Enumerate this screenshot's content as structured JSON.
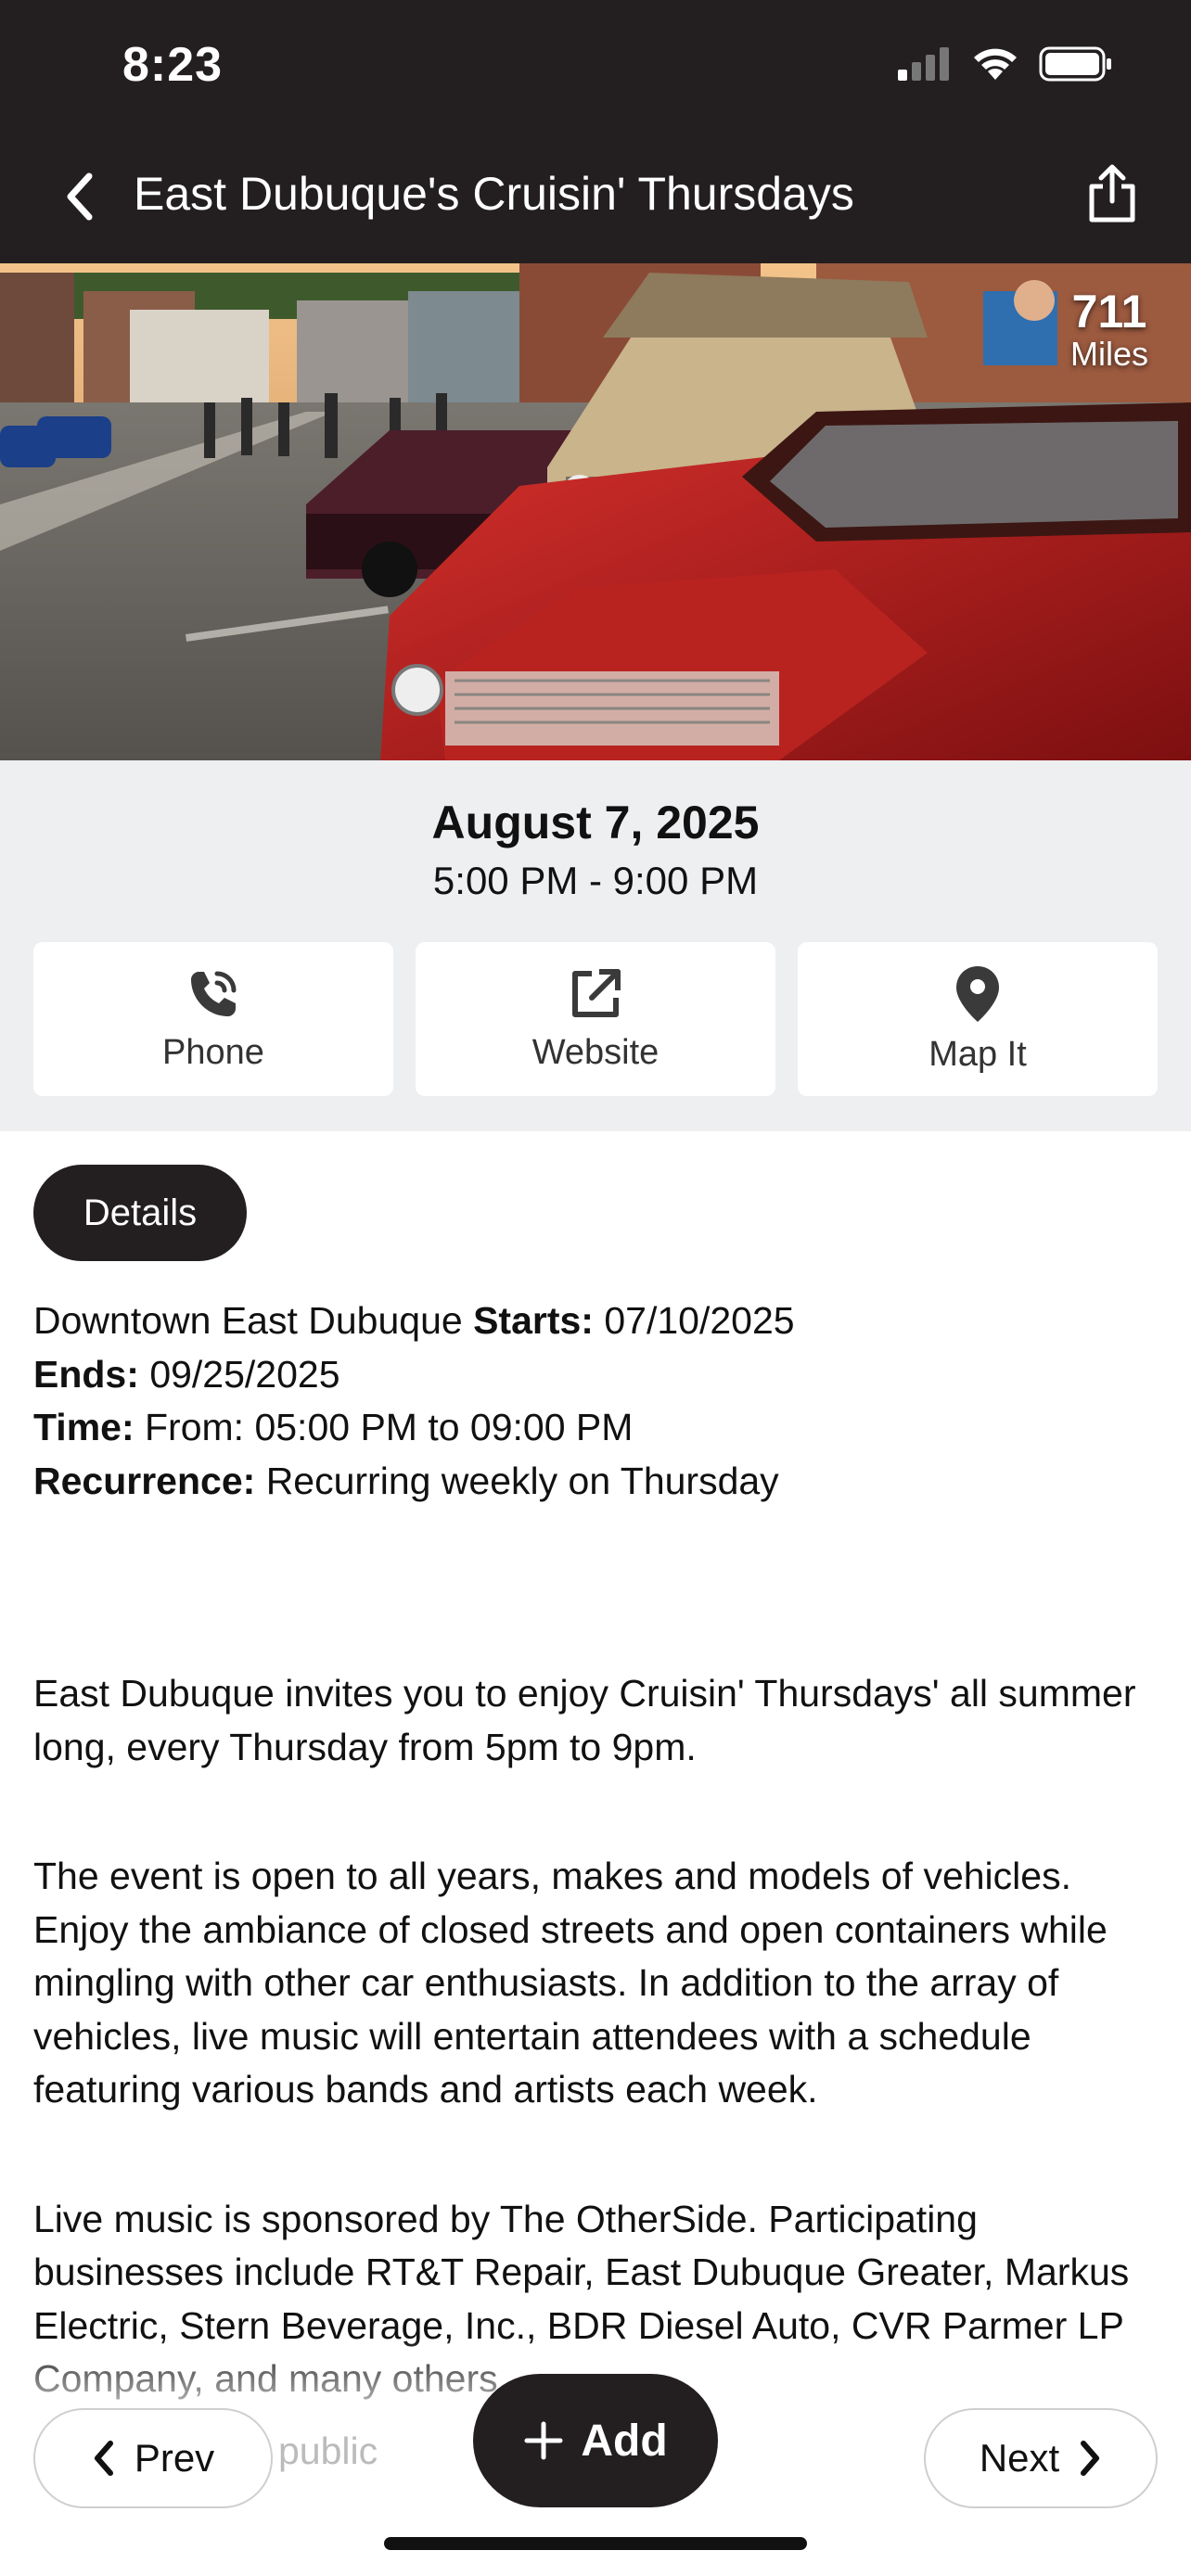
{
  "status_bar": {
    "time": "8:23",
    "icons": [
      "cellular-signal-icon",
      "wifi-icon",
      "battery-icon"
    ]
  },
  "nav": {
    "title": "East Dubuque's Cruisin' Thursdays",
    "back_icon": "chevron-left-icon",
    "share_icon": "share-icon"
  },
  "hero": {
    "image_description": "classic cars parked along a downtown street",
    "distance_value": "711",
    "distance_unit": "Miles"
  },
  "event": {
    "date": "August 7, 2025",
    "time": "5:00 PM - 9:00 PM"
  },
  "actions": [
    {
      "label": "Phone",
      "icon": "phone-icon"
    },
    {
      "label": "Website",
      "icon": "external-link-icon"
    },
    {
      "label": "Map It",
      "icon": "map-pin-icon"
    }
  ],
  "details": {
    "tab_label": "Details",
    "location": "Downtown East Dubuque",
    "starts_label": "Starts:",
    "starts_value": "07/10/2025",
    "ends_label": "Ends:",
    "ends_value": "09/25/2025",
    "time_label": "Time:",
    "time_value": "From: 05:00 PM to 09:00 PM",
    "recurrence_label": "Recurrence:",
    "recurrence_value": "Recurring weekly on Thursday",
    "paragraphs": [
      "East Dubuque invites you to enjoy Cruisin' Thursdays' all summer long, every Thursday from 5pm to 9pm.",
      "The event is open to all years, makes and models of vehicles. Enjoy the ambiance of closed streets and open containers while mingling with other car enthusiasts. In addition to the array of vehicles, live music will entertain attendees with a schedule featuring various bands and artists each week.",
      "Live music is sponsored by The OtherSide. Participating businesses include RT&T Repair, East Dubuque Greater, Markus Electric, Stern Beverage, Inc., BDR Diesel Auto, CVR Parmer LP Company, and many others."
    ],
    "partial_line": "public"
  },
  "bottom_bar": {
    "prev_label": "Prev",
    "add_label": "Add",
    "next_label": "Next"
  }
}
